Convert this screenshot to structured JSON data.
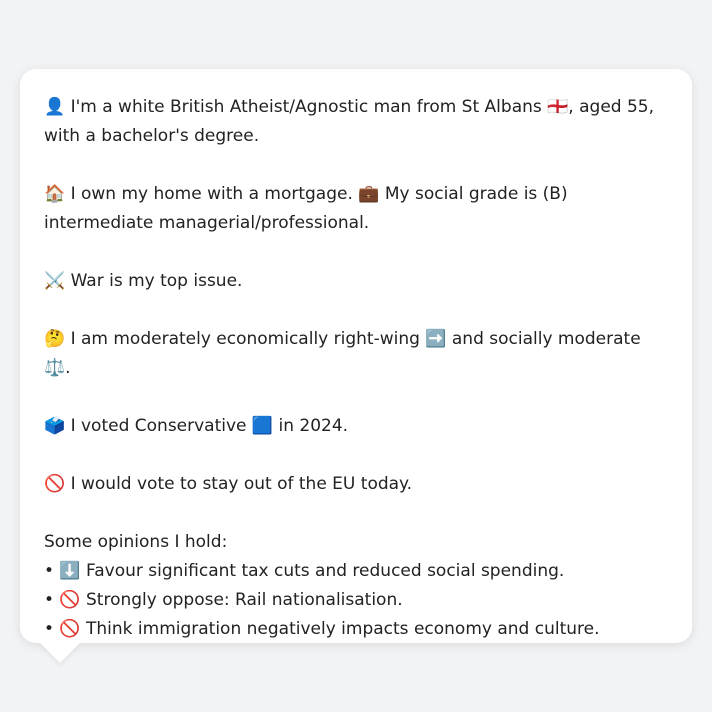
{
  "lines": {
    "identity": "👤 I'm a white British Atheist/Agnostic man from St Albans 🏴󠁧󠁢󠁥󠁮󠁧󠁿, aged 55, with a bachelor's degree.",
    "home": "🏠 I own my home with a mortgage. 💼 My social grade is (B) intermediate managerial/professional.",
    "issue": "⚔️ War is my top issue.",
    "ideology": "🤔 I am moderately economically right-wing ➡️ and socially moderate ⚖️.",
    "vote": "🗳️ I voted Conservative 🟦 in 2024.",
    "eu": "🚫 I would vote to stay out of the EU today."
  },
  "opinions": {
    "heading": "Some opinions I hold:",
    "items": [
      "• ⬇️ Favour significant tax cuts and reduced social spending.",
      "• 🚫 Strongly oppose: Rail nationalisation.",
      "• 🚫 Think immigration negatively impacts economy and culture."
    ]
  },
  "colors": {
    "background": "#f2f3f5",
    "bubble": "#ffffff",
    "text": "#222222"
  }
}
